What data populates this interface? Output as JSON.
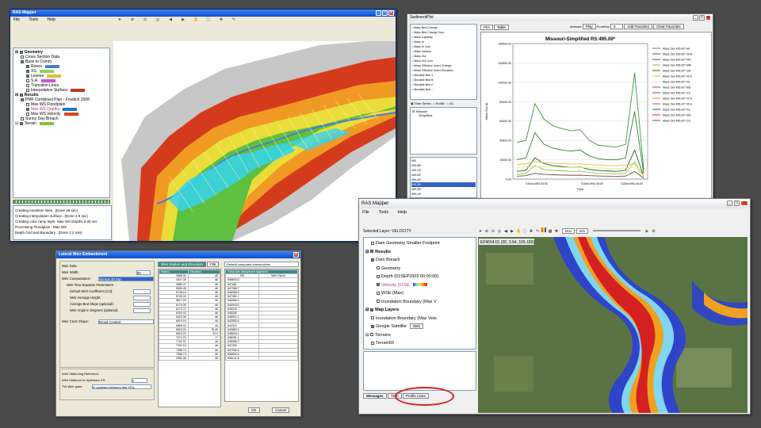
{
  "mapper1": {
    "title": "RAS Mapper",
    "menu": [
      "File",
      "Tools",
      "Help"
    ],
    "tree": [
      {
        "label": "Geometry",
        "indent": 0,
        "bold": true,
        "checked": true
      },
      {
        "label": "Cross Section Data",
        "indent": 1,
        "checked": false
      },
      {
        "label": "Base to Comm",
        "indent": 1,
        "checked": true
      },
      {
        "label": "Rivers",
        "indent": 2,
        "checked": true,
        "swatch": "#4a7bd6"
      },
      {
        "label": "XS",
        "indent": 2,
        "checked": true,
        "swatch": "#8bd65a"
      },
      {
        "label": "Levees",
        "indent": 2,
        "checked": true,
        "swatch": "#d9c33a"
      },
      {
        "label": "S.A.",
        "indent": 2,
        "checked": false,
        "swatch": "#c45ad6"
      },
      {
        "label": "Transition Lines",
        "indent": 2,
        "checked": false
      },
      {
        "label": "Interpolation Surface",
        "indent": 2,
        "checked": false,
        "swatch": "#c43a1e"
      },
      {
        "label": "Results",
        "indent": 0,
        "bold": true,
        "checked": true
      },
      {
        "label": "PMF Combined Plan - Froelich 2008",
        "indent": 1,
        "checked": true
      },
      {
        "label": "Max WS Floodplain",
        "indent": 2,
        "checked": false
      },
      {
        "label": "Max WS Depths",
        "indent": 2,
        "checked": true,
        "swatch": "#1a7ad6",
        "highlight": true
      },
      {
        "label": "Max WS Velocity",
        "indent": 2,
        "checked": false,
        "swatch": "#d64a1a"
      },
      {
        "label": "Sunny Day Breach",
        "indent": 1,
        "checked": false
      },
      {
        "label": "Terrain",
        "indent": 0,
        "checked": true,
        "swatch": "#8bbf3a"
      }
    ],
    "log": [
      "Creating transition lines  ..(Done 36 sec)",
      "Creating interpolation surface ..(Done 2.9 sec)",
      "Creating color ramp layer: Max WS Depths 0.00 sec",
      "Processing Floodplain : Max WS",
      "  Depth Grid and Boundary ..(Done 2.2 min)"
    ]
  },
  "sediment": {
    "title": "SedimentPlot",
    "tabs": [
      "Plot",
      "Table"
    ],
    "variables": [
      "Mass Bed Change",
      "Mass Bed Change Cum",
      "Mass Capacity",
      "Mass In",
      "Mass In Cum",
      "Mass Inactive",
      "Mass Out",
      "Mass Out Cum",
      "Mean Effective Invert Change",
      "Mean Effective Invert Elevation",
      "Movable Bed 1",
      "Movable Bed B",
      "Movable Bed C",
      "Movable Bed ..."
    ],
    "radios": [
      "Time Series",
      "Profile",
      "XS"
    ],
    "river": "Missouri",
    "reach": "Simplified",
    "stations": [
      "500",
      "499.88*",
      "499.75*",
      "499.63*",
      "499.50*",
      "499.38*",
      "499.25*",
      "499.13*"
    ],
    "toolbar": {
      "animate": "Animate",
      "play": "Play",
      "frames": "FrontSec",
      "frames_value": "5",
      "add": "Add Favorites",
      "clear": "Clear Favorites"
    }
  },
  "chart_data": {
    "type": "line",
    "title": "Missouri-Simplified  RS:495.00*",
    "ylabel": "Mass Out (t)",
    "xlabel": "Time",
    "ylim": [
      0,
      140000
    ],
    "yticks": [
      0,
      20000,
      40000,
      60000,
      80000,
      100000,
      120000,
      140000
    ],
    "ytick_labels": [
      "0.00",
      "20000.00",
      "40000.00",
      "60000.00",
      "80000.00",
      "100000.00",
      "120000.00",
      "140000.00"
    ],
    "xticks": [
      "01Nov1993 00:00",
      "01Mar1994 00:00",
      "01Mar1994 00:00"
    ],
    "legend_placement": "right",
    "series": [
      {
        "name": "Mass Out 495.00* All",
        "color": "#3a9a3a",
        "values": [
          38000,
          40000,
          78000,
          62000,
          55000,
          52000,
          50000,
          51000,
          40000,
          35000,
          34000,
          33000,
          36000,
          110000,
          10000
        ]
      },
      {
        "name": "Mass Out 495.00* VFM",
        "color": "#2e7d2e",
        "values": [
          20000,
          22000,
          48000,
          36000,
          32000,
          30000,
          29000,
          30000,
          24000,
          21000,
          20000,
          20000,
          22000,
          70000,
          6000
        ]
      },
      {
        "name": "Mass Out 495.00* FM",
        "color": "#1f5e1f",
        "values": [
          8000,
          9000,
          22000,
          16000,
          14000,
          13000,
          12000,
          12500,
          10000,
          9000,
          8500,
          8000,
          9000,
          30000,
          3000
        ]
      },
      {
        "name": "Mass Out 495.00* MM",
        "color": "#8bc34a",
        "values": [
          5000,
          6000,
          14000,
          10000,
          9000,
          8500,
          8000,
          8200,
          7000,
          6000,
          5800,
          5600,
          6000,
          18000,
          2000
        ]
      },
      {
        "name": "Mass Out 495.00* CM",
        "color": "#6d4c41",
        "values": [
          3000,
          3500,
          6000,
          5000,
          4500,
          4200,
          4000,
          4100,
          3500,
          3200,
          3000,
          2900,
          3100,
          8000,
          1000
        ]
      },
      {
        "name": "Mass Out 495.00* VFS",
        "color": "#d6c93a",
        "values": [
          15000,
          16000,
          18000,
          17000,
          16500,
          16000,
          15500,
          15800,
          15000,
          14500,
          14000,
          14000,
          14500,
          16000,
          4000
        ]
      },
      {
        "name": "Mass Out 495.00* FS",
        "color": "#f0e68c",
        "values": [
          12000,
          12500,
          13000,
          12800,
          12500,
          12200,
          12000,
          12100,
          11800,
          11500,
          11200,
          11000,
          11500,
          12500,
          3000
        ]
      }
    ],
    "legend_extra": [
      "Mass Out 495.00* MS",
      "Mass Out 495.00* CS",
      "Mass Out 495.00* VCS",
      "Mass Out 495.00* VFG",
      "Mass Out 495.00* FG",
      "Mass Out 495.00* MG",
      "Mass Out 495.00* CG"
    ],
    "legend_extra_colors": [
      "#a0522d",
      "#c0392b",
      "#e67e22",
      "#9b59b6",
      "#34495e",
      "#e91e63",
      "#795548"
    ]
  },
  "weir": {
    "title": "Lateral Weir Embankment",
    "weir_data": "Weir Data",
    "weir_width_label": "Weir Width:",
    "weir_width_value": "50",
    "weir_comp_label": "Weir Computations:",
    "weir_comp_value": "Normal 2D Eqn",
    "params_label": "Weir Flow Equation Parameters",
    "param_labels": [
      "Default Weir Coefficient (Cd):",
      "Weir Average Height:",
      "Average Bed Slope (optional):",
      "Weir Angle in Degrees (optional):"
    ],
    "crest_label": "Weir Crest Shape:",
    "crest_value": "Broad Crested",
    "tab_station": "Weir Station and Elevation",
    "tab_file": "File",
    "col_station": "Station",
    "col_elevation": "Elevation",
    "rows": [
      [
        "3668.30",
        "46"
      ],
      [
        "4347.46",
        "46"
      ],
      [
        "4889.47",
        "46"
      ],
      [
        "5359.48",
        "46"
      ],
      [
        "5748.18",
        "46"
      ],
      [
        "5740.05",
        "46"
      ],
      [
        "5817.09",
        "46"
      ],
      [
        "6175.30",
        "46"
      ],
      [
        "6173.71",
        "46"
      ],
      [
        "6200.03",
        "46"
      ],
      [
        "6322.06",
        "46"
      ],
      [
        "6519.16",
        "46"
      ],
      [
        "6856.02",
        "46"
      ],
      [
        "6816.00",
        "78.45"
      ],
      [
        "6615.22",
        "23.6"
      ],
      [
        "7072.20",
        "17"
      ],
      [
        "7192.91",
        "46"
      ],
      [
        "7232.16",
        "46"
      ],
      [
        "7355.73",
        "46"
      ],
      [
        "7596.73",
        "46"
      ],
      [
        "2962.46",
        "46"
      ]
    ],
    "right_select": "Default computed intersections",
    "right_header": "Tribal weir along levee segments",
    "right_col_rs": "RS",
    "right_col_ws": "Weir Sta Ar",
    "right_rows": [
      "658633.3",
      "647681",
      "647365.7",
      "646968.3",
      "647081.1",
      "646966.3",
      "646900.5",
      "646233",
      "646265",
      "646011.1",
      "643983.6",
      "642322",
      "640683.4",
      "638633.1",
      "638281.1",
      "636085.3",
      "637200",
      "637082.6",
      "636500.6",
      "636141.8"
    ],
    "ref_title": "Weir Stationing Reference",
    "ref_label1": "Weir Distance to Upstream XS:",
    "ref_value1": "0",
    "ref_label2": "TW Weir goes:",
    "ref_value2": "Is upsteam between last XS's",
    "ok": "OK",
    "cancel": "Cancel"
  },
  "mapper2": {
    "title": "RAS Mapper",
    "menu": [
      "File",
      "Tools",
      "Help"
    ],
    "selected_layer": "Selected Layer: VELOCITY",
    "zoom_label": "Max",
    "zoom_label2": "Min",
    "coords": "EF9654.01 (00, 3.64, 105.183)",
    "tree": [
      {
        "label": "Dam Geometry Smaller Footprint",
        "indent": 1,
        "checked": false
      },
      {
        "label": "Results",
        "indent": 0,
        "bold": true,
        "checked": true
      },
      {
        "label": "Dam Breach",
        "indent": 1,
        "checked": true
      },
      {
        "label": "Geometry",
        "indent": 2,
        "checked": false
      },
      {
        "label": "Depth (01SEP2003 00:00:00)",
        "indent": 2,
        "checked": false
      },
      {
        "label": "Velocity (01SE",
        "indent": 2,
        "checked": true,
        "swatch": "rainbow",
        "highlight": true
      },
      {
        "label": "WSE (Max)",
        "indent": 2,
        "checked": false
      },
      {
        "label": "Inundation Boundary (Max V",
        "indent": 2,
        "checked": false
      },
      {
        "label": "Map Layers",
        "indent": 0,
        "bold": true,
        "checked": true
      },
      {
        "label": "Inundation Boundary (Max Velo",
        "indent": 1,
        "checked": false
      },
      {
        "label": "Google Satellite",
        "indent": 1,
        "checked": true,
        "extra": "Web"
      },
      {
        "label": "Terrains",
        "indent": 0,
        "checked": false
      },
      {
        "label": "Terrain50",
        "indent": 1,
        "checked": false
      }
    ],
    "tabs": [
      "Messages",
      "Time",
      "Profile Lines"
    ]
  }
}
